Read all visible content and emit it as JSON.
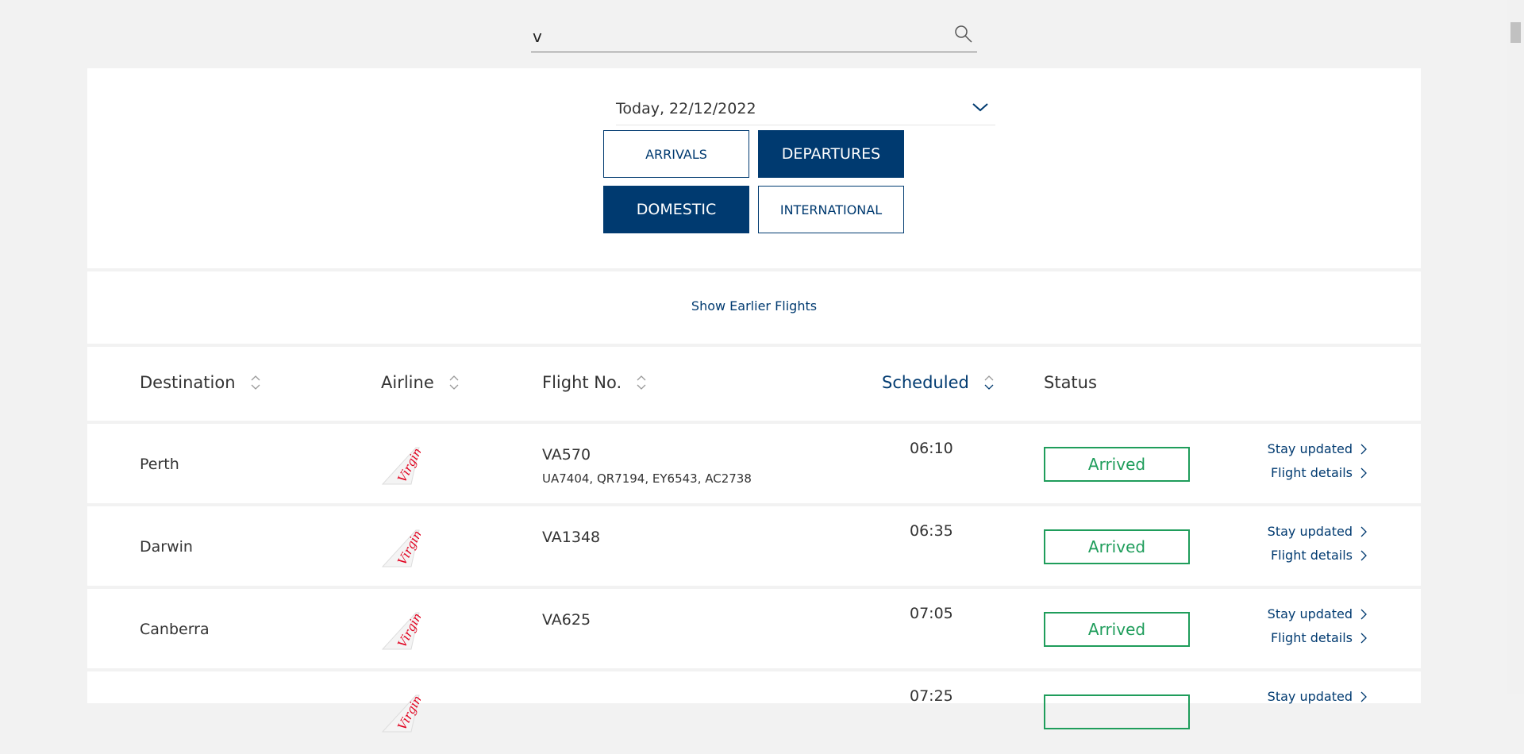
{
  "search": {
    "value": "v",
    "icon": "search-icon"
  },
  "date_select": {
    "value": "Today, 22/12/2022",
    "icon": "chevron-down-icon"
  },
  "direction_tabs": [
    {
      "label": "ARRIVALS",
      "active": false
    },
    {
      "label": "DEPARTURES",
      "active": true
    }
  ],
  "region_tabs": [
    {
      "label": "DOMESTIC",
      "active": true
    },
    {
      "label": "INTERNATIONAL",
      "active": false
    }
  ],
  "show_earlier": "Show Earlier Flights",
  "columns": [
    "Destination",
    "Airline",
    "Flight No.",
    "Scheduled",
    "Status"
  ],
  "colors": {
    "navy": "#003a70",
    "green": "#1f9d5b",
    "logo_red": "#e1001e"
  },
  "flights": [
    {
      "destination": "Perth",
      "airline": "Virgin",
      "flight": "VA570",
      "codeshare": "UA7404, QR7194, EY6543, AC2738",
      "scheduled": "06:10",
      "status": "Arrived",
      "link1": "Stay updated",
      "link2": "Flight details"
    },
    {
      "destination": "Darwin",
      "airline": "Virgin",
      "flight": "VA1348",
      "codeshare": "",
      "scheduled": "06:35",
      "status": "Arrived",
      "link1": "Stay updated",
      "link2": "Flight details"
    },
    {
      "destination": "Canberra",
      "airline": "Virgin",
      "flight": "VA625",
      "codeshare": "",
      "scheduled": "07:05",
      "status": "Arrived",
      "link1": "Stay updated",
      "link2": "Flight details"
    },
    {
      "destination": "",
      "airline": "Virgin",
      "flight": "",
      "codeshare": "",
      "scheduled": "07:25",
      "status": "",
      "link1": "Stay updated",
      "link2": ""
    }
  ]
}
